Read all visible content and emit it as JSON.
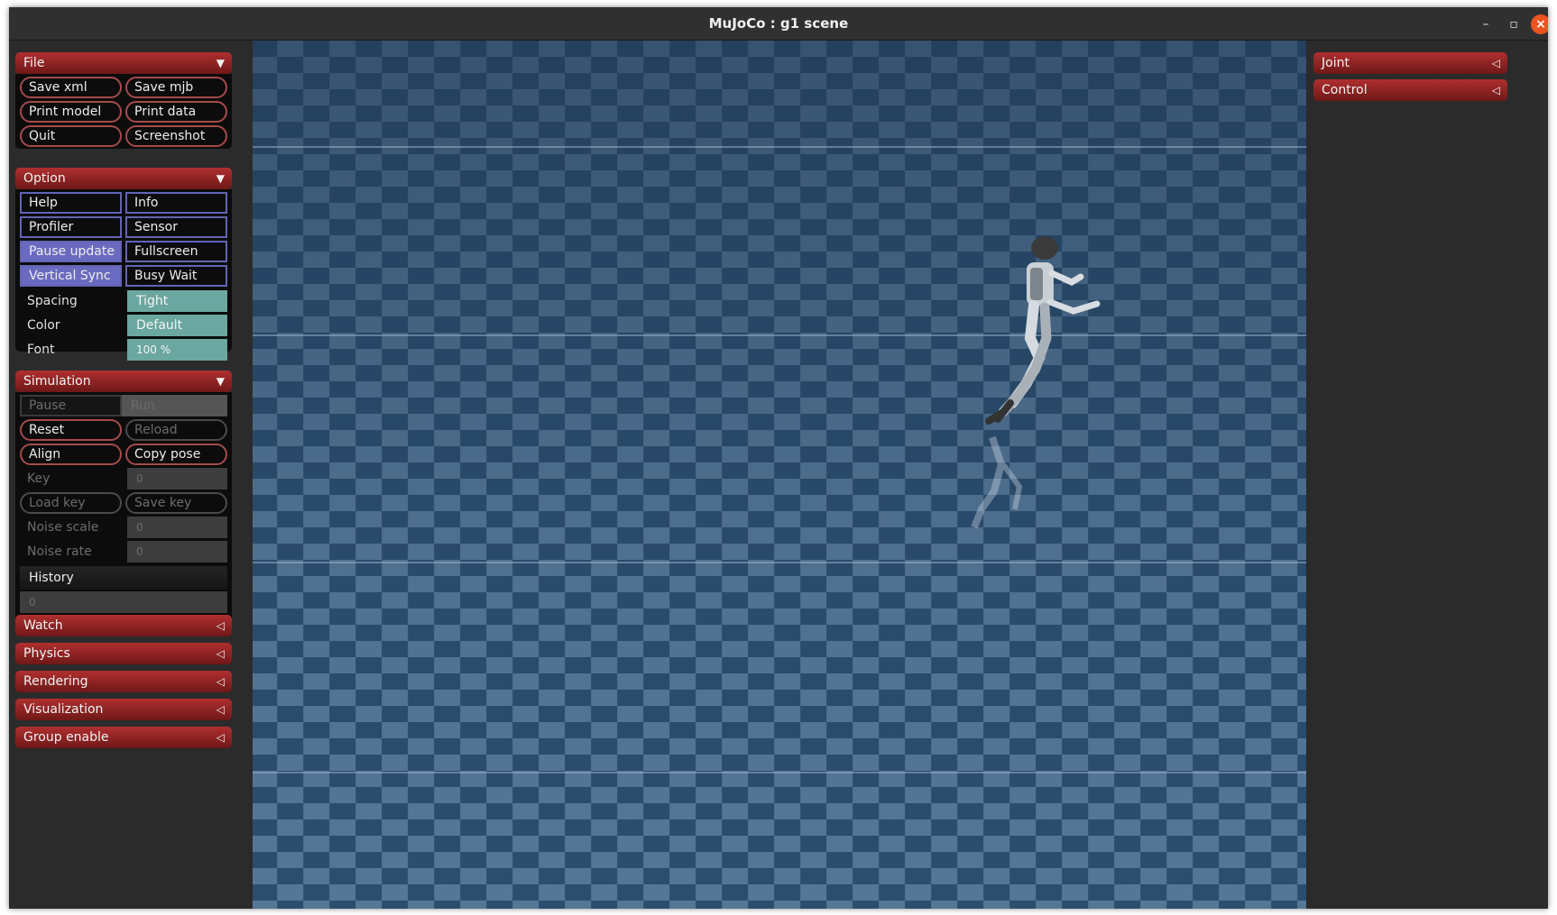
{
  "window": {
    "title": "MuJoCo : g1 scene",
    "controls": {
      "minimize": "–",
      "maximize": "▫",
      "close": "×"
    }
  },
  "left_panel": {
    "file": {
      "header": "File",
      "arrow": "▼",
      "buttons": [
        "Save xml",
        "Save mjb",
        "Print model",
        "Print data",
        "Quit",
        "Screenshot"
      ]
    },
    "option": {
      "header": "Option",
      "arrow": "▼",
      "checks": [
        {
          "label": "Help",
          "on": false
        },
        {
          "label": "Info",
          "on": false
        },
        {
          "label": "Profiler",
          "on": false
        },
        {
          "label": "Sensor",
          "on": false
        },
        {
          "label": "Pause update",
          "on": true
        },
        {
          "label": "Fullscreen",
          "on": false
        },
        {
          "label": "Vertical Sync",
          "on": true
        },
        {
          "label": "Busy Wait",
          "on": false
        }
      ],
      "spacing_label": "Spacing",
      "spacing_value": "Tight",
      "color_label": "Color",
      "color_value": "Default",
      "font_label": "Font",
      "font_value": "100 %"
    },
    "simulation": {
      "header": "Simulation",
      "arrow": "▼",
      "pause": "Pause",
      "run": "Run",
      "reset": "Reset",
      "reload": "Reload",
      "align": "Align",
      "copy_pose": "Copy pose",
      "key_label": "Key",
      "key_value": "0",
      "load_key": "Load key",
      "save_key": "Save key",
      "noise_scale_label": "Noise scale",
      "noise_scale_value": "0",
      "noise_rate_label": "Noise rate",
      "noise_rate_value": "0",
      "history_label": "History",
      "history_value": "0"
    },
    "collapsed": [
      {
        "label": "Watch",
        "arrow": "◁"
      },
      {
        "label": "Physics",
        "arrow": "◁"
      },
      {
        "label": "Rendering",
        "arrow": "◁"
      },
      {
        "label": "Visualization",
        "arrow": "◁"
      },
      {
        "label": "Group enable",
        "arrow": "◁"
      }
    ]
  },
  "right_panel": {
    "collapsed": [
      {
        "label": "Joint",
        "arrow": "◁"
      },
      {
        "label": "Control",
        "arrow": "◁"
      }
    ]
  },
  "colors": {
    "section_header": "#a02828",
    "checker_dark": "#2b4d6e",
    "checker_light": "#557797",
    "toggle_on": "#6a6ac0",
    "select_teal": "#6aa7a0"
  }
}
